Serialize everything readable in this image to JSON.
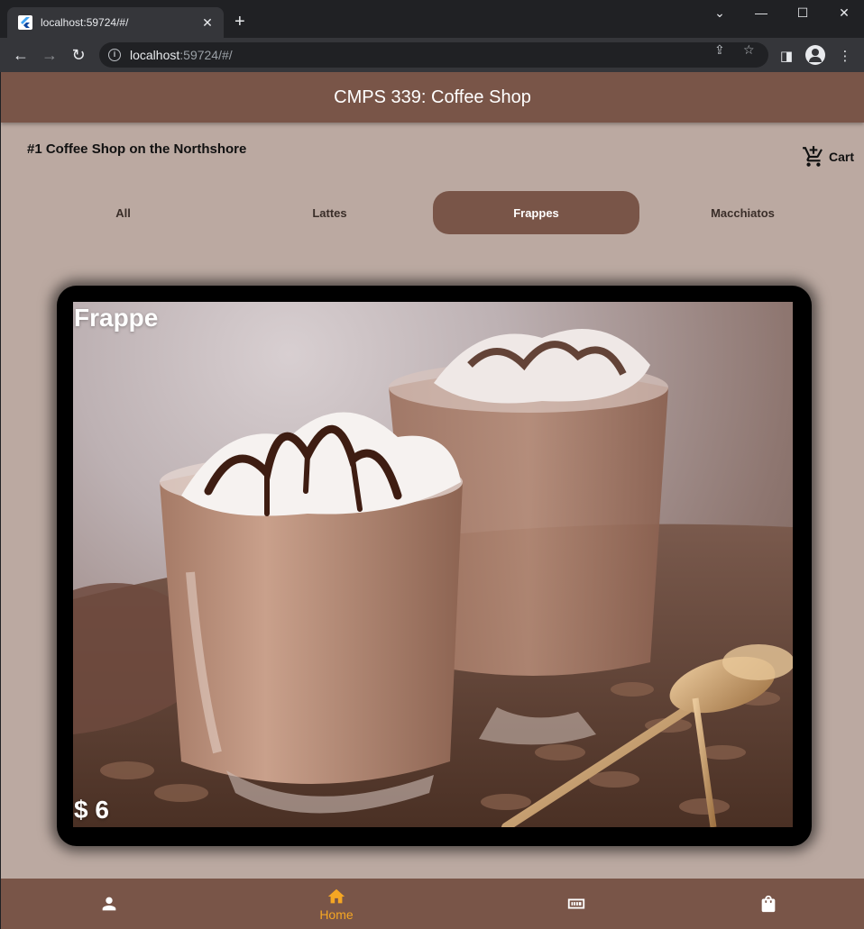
{
  "browser": {
    "tab_title": "localhost:59724/#/",
    "tab_close": "✕",
    "new_tab": "+",
    "url_host": "localhost",
    "url_path": ":59724/#/"
  },
  "app": {
    "title": "CMPS 339: Coffee Shop",
    "tagline": "#1 Coffee Shop on the Northshore",
    "cart_label": "Cart",
    "categories": [
      {
        "label": "All",
        "selected": false
      },
      {
        "label": "Lattes",
        "selected": false
      },
      {
        "label": "Frappes",
        "selected": true
      },
      {
        "label": "Macchiatos",
        "selected": false
      }
    ],
    "product": {
      "name": "Frappe",
      "price": "$ 6"
    },
    "bottom_nav": [
      {
        "icon": "person-icon",
        "label": "",
        "active": false
      },
      {
        "icon": "home-icon",
        "label": "Home",
        "active": true
      },
      {
        "icon": "ticket-icon",
        "label": "",
        "active": false
      },
      {
        "icon": "shopping-bag-icon",
        "label": "",
        "active": false
      }
    ]
  },
  "colors": {
    "appbar": "#795548",
    "background": "#bba9a1",
    "active_nav": "#f5a623"
  }
}
